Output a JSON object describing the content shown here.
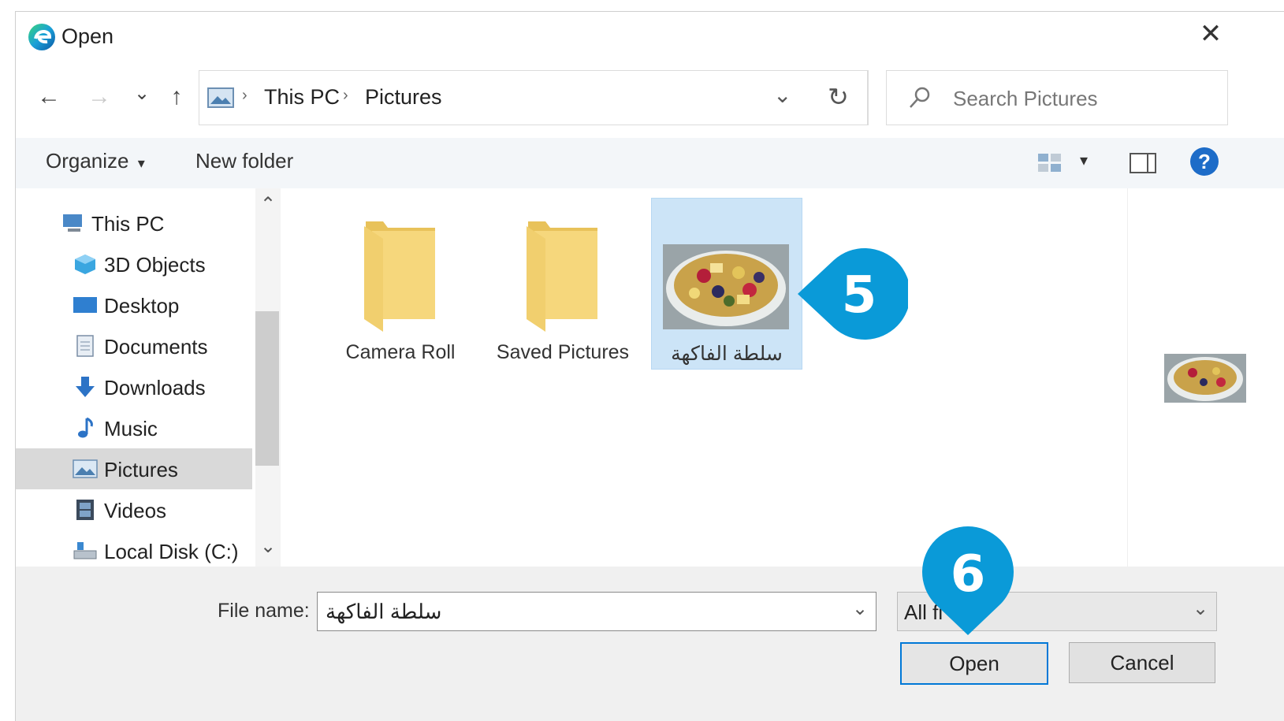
{
  "window": {
    "title": "Open",
    "close_glyph": "✕"
  },
  "navigation": {
    "back_glyph": "←",
    "forward_glyph": "→",
    "recent_glyph": "⌄",
    "up_glyph": "↑",
    "breadcrumb": [
      "This PC",
      "Pictures"
    ],
    "breadcrumb_separator": "›",
    "address_dropdown_glyph": "⌄",
    "refresh_glyph": "↻",
    "search_placeholder": "Search Pictures"
  },
  "toolbar": {
    "organize_label": "Organize",
    "organize_caret": "▾",
    "new_folder_label": "New folder",
    "view_caret": "▾",
    "help_glyph": "?"
  },
  "sidebar": {
    "items": [
      {
        "label": "This PC",
        "icon": "computer-icon",
        "selected": false
      },
      {
        "label": "3D Objects",
        "icon": "cube-icon",
        "selected": false
      },
      {
        "label": "Desktop",
        "icon": "desktop-icon",
        "selected": false
      },
      {
        "label": "Documents",
        "icon": "document-icon",
        "selected": false
      },
      {
        "label": "Downloads",
        "icon": "download-arrow-icon",
        "selected": false
      },
      {
        "label": "Music",
        "icon": "music-note-icon",
        "selected": false
      },
      {
        "label": "Pictures",
        "icon": "pictures-icon",
        "selected": true
      },
      {
        "label": "Videos",
        "icon": "film-icon",
        "selected": false
      },
      {
        "label": "Local Disk (C:)",
        "icon": "disk-drive-icon",
        "selected": false
      }
    ],
    "scroll_up_glyph": "⌃",
    "scroll_down_glyph": "⌄"
  },
  "files": [
    {
      "name": "Camera Roll",
      "type": "folder",
      "selected": false
    },
    {
      "name": "Saved Pictures",
      "type": "folder",
      "selected": false
    },
    {
      "name": "سلطة الفاكهة",
      "type": "image",
      "selected": true
    }
  ],
  "footer": {
    "file_name_label": "File name:",
    "file_name_value": "سلطة الفاكهة",
    "file_name_dropdown_glyph": "⌄",
    "file_type_value": "All fi",
    "file_type_dropdown_glyph": "⌄",
    "open_label": "Open",
    "cancel_label": "Cancel"
  },
  "callouts": [
    {
      "number": "5"
    },
    {
      "number": "6"
    }
  ],
  "colors": {
    "accent": "#0078d7",
    "callout": "#0a9ad8",
    "folder": "#f6d77c",
    "selection": "#cce4f7"
  }
}
